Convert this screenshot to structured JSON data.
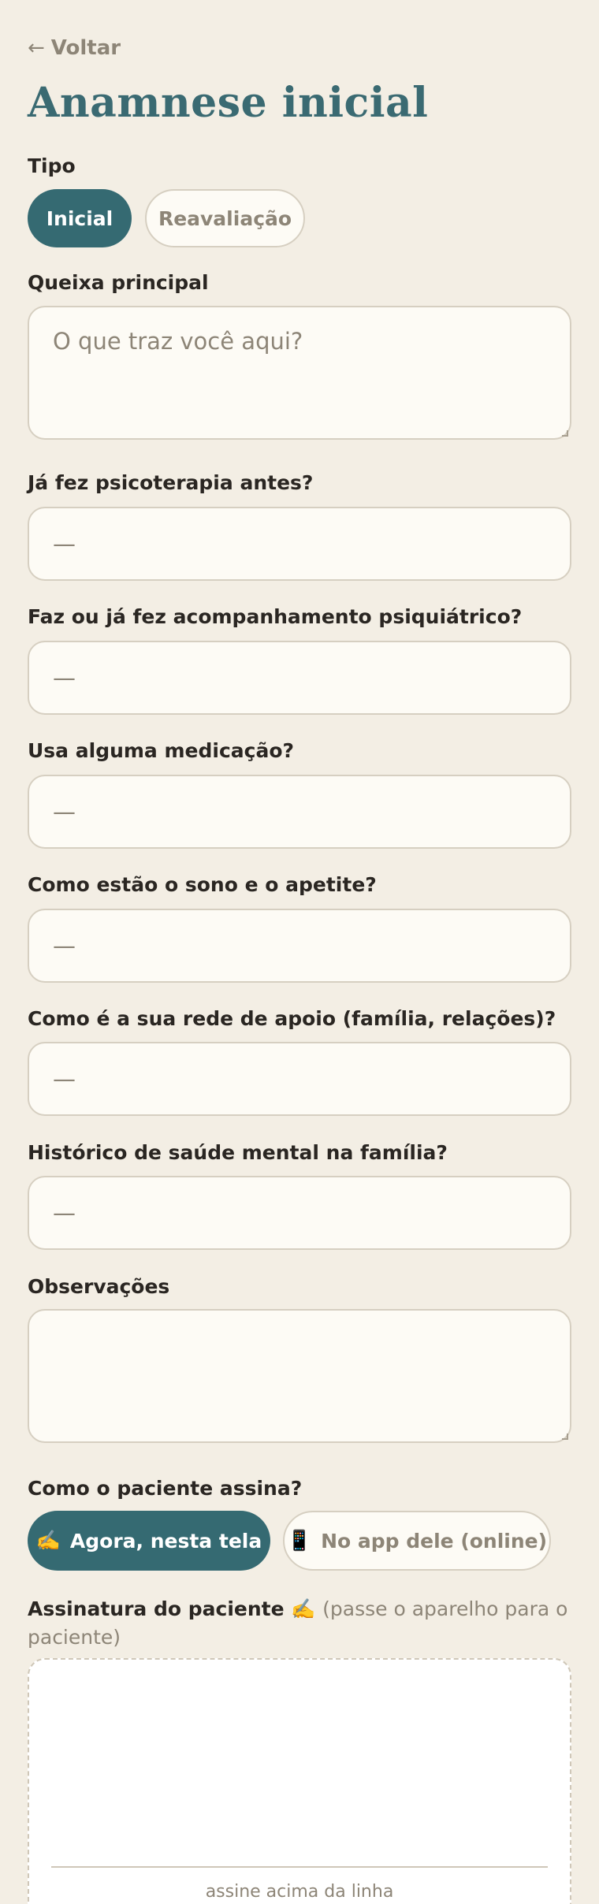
{
  "nav": {
    "back_arrow": "←",
    "back_label": "Voltar"
  },
  "page_title": "Anamnese inicial",
  "tipo": {
    "label": "Tipo",
    "options": [
      {
        "label": "Inicial",
        "selected": true
      },
      {
        "label": "Reavaliação",
        "selected": false
      }
    ]
  },
  "queixa": {
    "label": "Queixa principal",
    "placeholder": "O que traz você aqui?"
  },
  "questions": [
    {
      "label": "Já fez psicoterapia antes?",
      "value": "—"
    },
    {
      "label": "Faz ou já fez acompanhamento psiquiátrico?",
      "value": "—"
    },
    {
      "label": "Usa alguma medicação?",
      "value": "—"
    },
    {
      "label": "Como estão o sono e o apetite?",
      "value": "—"
    },
    {
      "label": "Como é a sua rede de apoio (família, relações)?",
      "value": "—"
    },
    {
      "label": "Histórico de saúde mental na família?",
      "value": "—"
    }
  ],
  "observacoes": {
    "label": "Observações",
    "value": ""
  },
  "assinatura_modo": {
    "label": "Como o paciente assina?",
    "options": [
      {
        "icon": "✍️",
        "icon_name": "writing-hand-icon",
        "label": "Agora, nesta tela",
        "selected": true
      },
      {
        "icon": "📱",
        "icon_name": "mobile-phone-icon",
        "label": "No app dele (online)",
        "selected": false
      }
    ]
  },
  "assinatura": {
    "label": "Assinatura do paciente",
    "icon": "✍️",
    "hint": "(passe o aparelho para o paciente)",
    "line_caption": "assine acima da linha"
  },
  "colors": {
    "background": "#F3EEE4",
    "accent": "#356A72",
    "field_bg": "#FDFBF5",
    "border": "#D6CFC1",
    "muted_text": "#8D8577"
  }
}
